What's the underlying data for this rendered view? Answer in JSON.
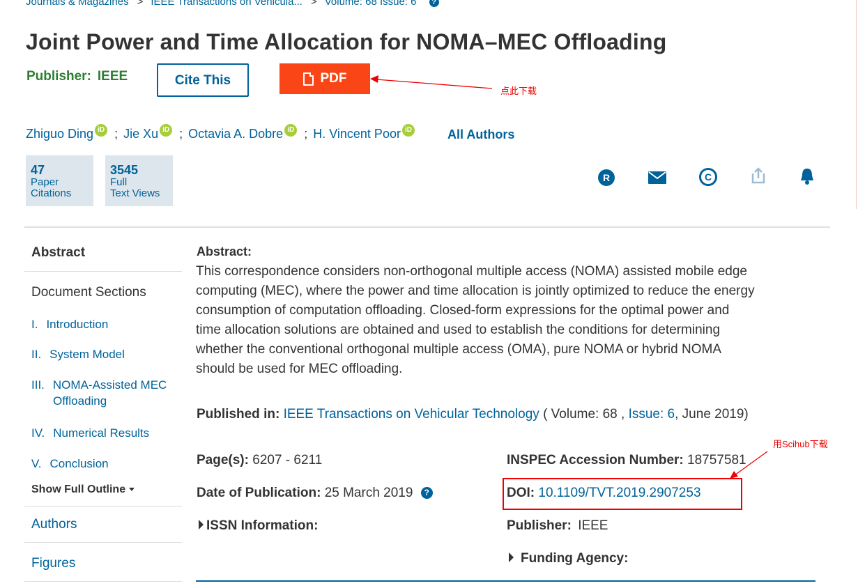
{
  "breadcrumb": {
    "items": [
      "Journals & Magazines",
      "IEEE Transactions on Vehicula...",
      "Volume: 68 Issue: 6"
    ],
    "separator": ">",
    "help_glyph": "?"
  },
  "title": "Joint Power and Time Allocation for NOMA–MEC Offloading",
  "publisher": {
    "label": "Publisher:",
    "value": "IEEE"
  },
  "buttons": {
    "cite": "Cite This",
    "pdf": "PDF"
  },
  "annotations": {
    "pdf_note": "点此下载",
    "doi_note": "用Scihub下载",
    "color": "#e00000"
  },
  "authors": {
    "list": [
      "Zhiguo Ding",
      "Jie Xu",
      "Octavia A. Dobre",
      "H. Vincent Poor"
    ],
    "separator": ";",
    "orcid_glyph": "iD",
    "all_authors": "All Authors"
  },
  "metrics": [
    {
      "value": "47",
      "line1": "Paper",
      "line2": "Citations"
    },
    {
      "value": "3545",
      "line1": "Full",
      "line2": "Text Views"
    }
  ],
  "action_icons": [
    "rights-icon",
    "email-icon",
    "copyright-icon",
    "share-icon",
    "alert-bell-icon"
  ],
  "nav": {
    "abstract": "Abstract",
    "document_sections": "Document Sections",
    "sections": [
      {
        "num": "I.",
        "label": "Introduction"
      },
      {
        "num": "II.",
        "label": "System Model"
      },
      {
        "num": "III.",
        "label": "NOMA-Assisted MEC",
        "label2": "Offloading"
      },
      {
        "num": "IV.",
        "label": "Numerical Results"
      },
      {
        "num": "V.",
        "label": "Conclusion"
      }
    ],
    "show_outline": "Show Full Outline",
    "authors": "Authors",
    "figures": "Figures"
  },
  "abstract": {
    "heading": "Abstract:",
    "lines": [
      "This correspondence considers non-orthogonal multiple access (NOMA) assisted mobile edge",
      "computing (MEC), where the power and time allocation is jointly optimized to reduce the energy",
      "consumption of computation offloading. Closed-form expressions for the optimal power and",
      "time allocation solutions are obtained and used to establish the conditions for determining",
      "whether the conventional orthogonal multiple access (OMA), pure NOMA or hybrid NOMA",
      "should be used for MEC offloading."
    ]
  },
  "published_in": {
    "label": "Published in:",
    "journal": "IEEE Transactions on Vehicular Technology",
    "open": "( Volume: 68 ,",
    "issue_label": "Issue: 6",
    "close": ", June 2019)"
  },
  "details": {
    "pages_label": "Page(s):",
    "pages": "6207 - 6211",
    "date_label": "Date of Publication:",
    "date": "25 March 2019",
    "issn": "ISSN Information:",
    "inspec_label": "INSPEC Accession Number:",
    "inspec": "18757581",
    "doi_label": "DOI:",
    "doi": "10.1109/TVT.2019.2907253",
    "publisher_label": "Publisher:",
    "publisher": "IEEE",
    "funding": "Funding Agency:"
  }
}
